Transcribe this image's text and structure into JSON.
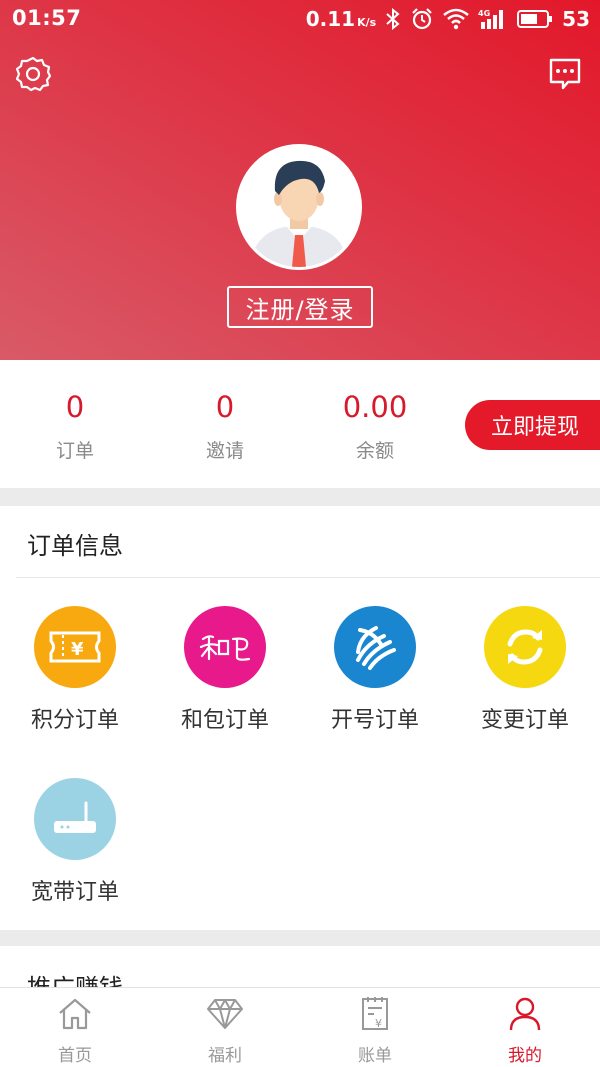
{
  "status_bar": {
    "time": "01:57",
    "net_speed": "0.11",
    "net_unit": "K/s",
    "battery": "53"
  },
  "header": {
    "login_label": "注册/登录"
  },
  "stats": {
    "orders": {
      "value": "0",
      "label": "订单"
    },
    "invites": {
      "value": "0",
      "label": "邀请"
    },
    "balance": {
      "value": "0.00",
      "label": "余额"
    },
    "withdraw_label": "立即提现"
  },
  "orders_section": {
    "title": "订单信息",
    "items": [
      {
        "label": "积分订单",
        "icon": "ticket-yen-icon",
        "color": "#f7a90f"
      },
      {
        "label": "和包订单",
        "icon": "hebao-icon",
        "color": "#e8198b"
      },
      {
        "label": "开号订单",
        "icon": "china-mobile-icon",
        "color": "#1b86d0"
      },
      {
        "label": "变更订单",
        "icon": "refresh-icon",
        "color": "#f5d80f"
      },
      {
        "label": "宽带订单",
        "icon": "router-icon",
        "color": "#9cd3e4"
      }
    ]
  },
  "promo_section": {
    "title": "推广赚钱"
  },
  "tabbar": {
    "items": [
      {
        "label": "首页",
        "icon": "home-icon"
      },
      {
        "label": "福利",
        "icon": "diamond-icon"
      },
      {
        "label": "账单",
        "icon": "bill-icon"
      },
      {
        "label": "我的",
        "icon": "person-icon",
        "active": true
      }
    ]
  },
  "colors": {
    "brand_red": "#e4192a",
    "accent_text": "#d7192c"
  }
}
